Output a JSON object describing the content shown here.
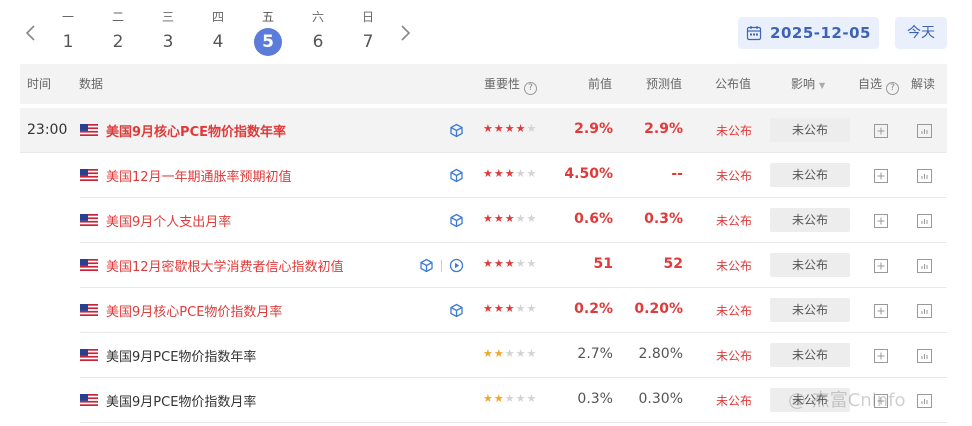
{
  "week": {
    "days": [
      {
        "wd": "一",
        "num": "1",
        "active": false
      },
      {
        "wd": "二",
        "num": "2",
        "active": false
      },
      {
        "wd": "三",
        "num": "3",
        "active": false
      },
      {
        "wd": "四",
        "num": "4",
        "active": false
      },
      {
        "wd": "五",
        "num": "5",
        "active": true
      },
      {
        "wd": "六",
        "num": "6",
        "active": false
      },
      {
        "wd": "日",
        "num": "7",
        "active": false
      }
    ],
    "prev_icon": "chevron-left-icon",
    "next_icon": "chevron-right-icon"
  },
  "date_picker": {
    "icon": "calendar-icon",
    "date": "2025-12-05"
  },
  "today_button": "今天",
  "columns": {
    "time": "时间",
    "data": "数据",
    "importance": "重要性",
    "previous": "前值",
    "forecast": "预测值",
    "actual": "公布值",
    "impact": "影响",
    "watch": "自选",
    "interpret": "解读"
  },
  "time_slot": "23:00",
  "rows": [
    {
      "country": "US",
      "title": "美国9月核心PCE物价指数年率",
      "title_color": "red",
      "bold": true,
      "icons": [
        "cube-icon"
      ],
      "stars": 4,
      "star_color": "red",
      "previous": "2.9%",
      "previous_color": "red",
      "forecast": "2.9%",
      "forecast_color": "red",
      "actual": "未公布",
      "impact": "未公布"
    },
    {
      "country": "US",
      "title": "美国12月一年期通胀率预期初值",
      "title_color": "red",
      "bold": false,
      "icons": [
        "cube-icon"
      ],
      "stars": 3,
      "star_color": "red",
      "previous": "4.50%",
      "previous_color": "red",
      "forecast": "--",
      "forecast_color": "red",
      "actual": "未公布",
      "impact": "未公布"
    },
    {
      "country": "US",
      "title": "美国9月个人支出月率",
      "title_color": "red",
      "bold": false,
      "icons": [
        "cube-icon"
      ],
      "stars": 3,
      "star_color": "red",
      "previous": "0.6%",
      "previous_color": "red",
      "forecast": "0.3%",
      "forecast_color": "red",
      "actual": "未公布",
      "impact": "未公布"
    },
    {
      "country": "US",
      "title": "美国12月密歇根大学消费者信心指数初值",
      "title_color": "red",
      "bold": false,
      "icons": [
        "cube-icon",
        "play-icon"
      ],
      "stars": 3,
      "star_color": "red",
      "previous": "51",
      "previous_color": "red",
      "forecast": "52",
      "forecast_color": "red",
      "actual": "未公布",
      "impact": "未公布"
    },
    {
      "country": "US",
      "title": "美国9月核心PCE物价指数月率",
      "title_color": "red",
      "bold": false,
      "icons": [
        "cube-icon"
      ],
      "stars": 3,
      "star_color": "red",
      "previous": "0.2%",
      "previous_color": "red",
      "forecast": "0.20%",
      "forecast_color": "red",
      "actual": "未公布",
      "impact": "未公布"
    },
    {
      "country": "US",
      "title": "美国9月PCE物价指数年率",
      "title_color": "black",
      "bold": false,
      "icons": [],
      "stars": 2,
      "star_color": "gold",
      "previous": "2.7%",
      "previous_color": "gray",
      "forecast": "2.80%",
      "forecast_color": "gray",
      "actual": "未公布",
      "impact": "未公布"
    },
    {
      "country": "US",
      "title": "美国9月PCE物价指数月率",
      "title_color": "black",
      "bold": false,
      "icons": [],
      "stars": 2,
      "star_color": "gold",
      "previous": "0.3%",
      "previous_color": "gray",
      "forecast": "0.30%",
      "forecast_color": "gray",
      "actual": "未公布",
      "impact": "未公布"
    }
  ],
  "watermark": "@ 杰富Cninfo",
  "colors": {
    "accent": "#5b7cd9",
    "red": "#e03a3a",
    "gold": "#f0a72a",
    "header_bg": "#f3f3f3",
    "date_bg": "#e9f0fb"
  }
}
